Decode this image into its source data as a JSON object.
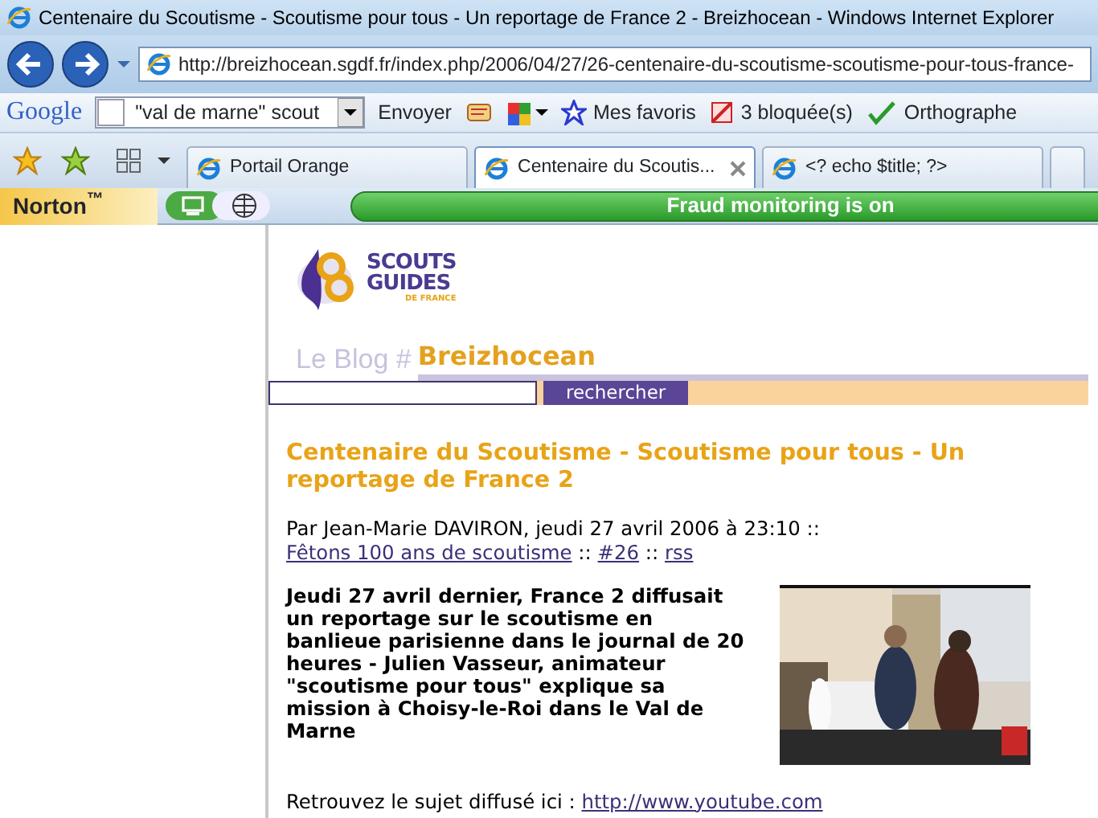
{
  "window": {
    "title": "Centenaire du Scoutisme - Scoutisme pour tous - Un reportage de France 2 - Breizhocean - Windows Internet Explorer"
  },
  "address_bar": {
    "url": "http://breizhocean.sgdf.fr/index.php/2006/04/27/26-centenaire-du-scoutisme-scoutisme-pour-tous-france-"
  },
  "google_toolbar": {
    "logo": "Google",
    "search_value": "\"val de marne\" scout",
    "send": "Envoyer",
    "favorites": "Mes favoris",
    "blocked": "3 bloquée(s)",
    "spelling": "Orthographe"
  },
  "tabs": [
    {
      "label": "Portail Orange",
      "selected": false,
      "closable": false
    },
    {
      "label": "Centenaire du Scoutis...",
      "selected": true,
      "closable": true
    },
    {
      "label": "<? echo $title; ?>",
      "selected": false,
      "closable": false
    }
  ],
  "norton": {
    "label": "Norton",
    "trademark": "™",
    "status": "Fraud monitoring is on"
  },
  "blog": {
    "logo_lines": [
      "SCOUTS",
      "GUIDES",
      "DE FRANCE"
    ],
    "prefix": "Le Blog #",
    "name": "Breizhocean",
    "search_button": "rechercher"
  },
  "post": {
    "title": "Centenaire du Scoutisme - Scoutisme pour tous - Un reportage de France 2",
    "meta": [
      {
        "text": "Par Jean-Marie DAVIRON, jeudi 27 avril 2006 à 23:10 :: ",
        "link": false
      },
      {
        "text": "Fêtons 100 ans de scoutisme",
        "link": true
      },
      {
        "text": " :: ",
        "link": false
      },
      {
        "text": "#26",
        "link": true
      },
      {
        "text": " :: ",
        "link": false
      },
      {
        "text": "rss",
        "link": true
      }
    ],
    "lead": "Jeudi 27 avril dernier, France 2 diffusait un reportage sur le scoutisme en banlieue parisienne dans le journal de 20 heures - Julien Vasseur, animateur \"scoutisme pour tous\" explique sa mission à Choisy-le-Roi dans le Val de Marne",
    "footer_text": "Retrouvez le sujet diffusé ici : ",
    "footer_link": "http://www.youtube.com"
  }
}
